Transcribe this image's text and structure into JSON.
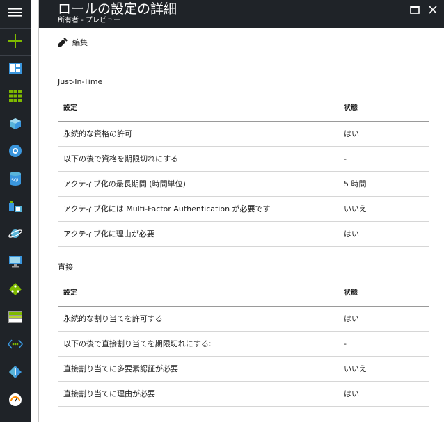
{
  "sidebar": {
    "items": [
      {
        "icon": "hamburger-menu-icon"
      },
      {
        "icon": "plus-new-icon",
        "color": "#7fba00"
      },
      {
        "icon": "dashboard-icon"
      },
      {
        "icon": "all-resources-icon"
      },
      {
        "icon": "cube-icon"
      },
      {
        "icon": "globe-icon"
      },
      {
        "icon": "sql-database-icon"
      },
      {
        "icon": "sql-server-icon"
      },
      {
        "icon": "cosmos-planet-icon"
      },
      {
        "icon": "virtual-machine-icon"
      },
      {
        "icon": "load-balancer-icon"
      },
      {
        "icon": "storage-icon"
      },
      {
        "icon": "virtual-network-icon"
      },
      {
        "icon": "active-directory-icon"
      },
      {
        "icon": "monitor-gauge-icon"
      }
    ]
  },
  "blade": {
    "title": "ロールの設定の詳細",
    "subtitle": "所有者 - プレビュー",
    "edit_label": "編集"
  },
  "sections": [
    {
      "title": "Just-In-Time",
      "columns": [
        "設定",
        "状態"
      ],
      "rows": [
        [
          "永続的な資格の許可",
          "はい"
        ],
        [
          "以下の後で資格を期限切れにする",
          "-"
        ],
        [
          "アクティブ化の最長期間 (時間単位)",
          "5 時間"
        ],
        [
          "アクティブ化には Multi-Factor Authentication が必要です",
          "いいえ"
        ],
        [
          "アクティブ化に理由が必要",
          "はい"
        ]
      ]
    },
    {
      "title": "直接",
      "columns": [
        "設定",
        "状態"
      ],
      "rows": [
        [
          "永続的な割り当てを許可する",
          "はい"
        ],
        [
          "以下の後で直接割り当てを期限切れにする:",
          "-"
        ],
        [
          "直接割り当てに多要素認証が必要",
          "いいえ"
        ],
        [
          "直接割り当てに理由が必要",
          "はい"
        ]
      ]
    }
  ],
  "colors": {
    "chrome": "#1f2328",
    "accent_green": "#7fba00",
    "azure_blue": "#0078d4"
  }
}
